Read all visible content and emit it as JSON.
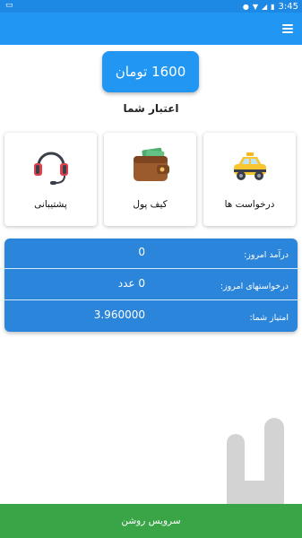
{
  "status_bar": {
    "time": "3:45",
    "icons": [
      "location-icon",
      "wifi-icon",
      "signal-icon",
      "battery-icon"
    ]
  },
  "app_bar": {
    "menu_icon": "hamburger-menu-icon"
  },
  "credit": {
    "amount_text": "1600 تومان",
    "label": "اعتبار شما"
  },
  "cards": [
    {
      "label": "پشتیبانی",
      "icon": "headset-icon"
    },
    {
      "label": "کیف پول",
      "icon": "wallet-icon"
    },
    {
      "label": "درخواست ها",
      "icon": "taxi-icon"
    }
  ],
  "stats": {
    "income_label": "درآمد امروز:",
    "income_value": "0",
    "requests_label": "درخواستهای امروز:",
    "requests_value": "0 عدد",
    "score_label": "امتیاز شما:",
    "score_value": "3.960000"
  },
  "footer": {
    "label": "سرویس روشن"
  },
  "colors": {
    "primary": "#2196f3",
    "status_bar": "#1e88e5",
    "stats_bg": "#2b85da",
    "footer": "#3aa547"
  }
}
